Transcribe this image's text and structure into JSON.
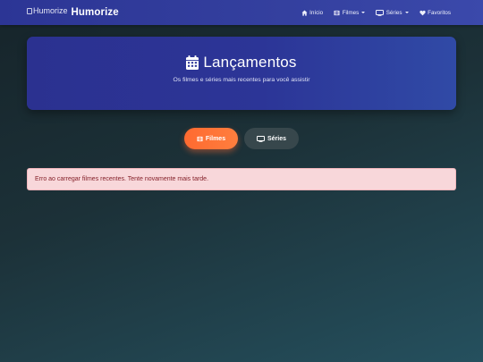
{
  "brand": {
    "logo_alt": "Humorize",
    "name": "Humorize"
  },
  "nav": {
    "items": [
      {
        "label": "Início",
        "icon": "home-icon",
        "dropdown": false
      },
      {
        "label": "Filmes",
        "icon": "film-icon",
        "dropdown": true
      },
      {
        "label": "Séries",
        "icon": "tv-icon",
        "dropdown": true
      },
      {
        "label": "Favoritos",
        "icon": "heart-icon",
        "dropdown": false
      }
    ]
  },
  "hero": {
    "icon": "calendar-icon",
    "title": "Lançamentos",
    "subtitle": "Os filmes e séries mais recentes para você assistir"
  },
  "tabs": [
    {
      "label": "Filmes",
      "icon": "film-icon",
      "active": true
    },
    {
      "label": "Séries",
      "icon": "tv-icon",
      "active": false
    }
  ],
  "alert": {
    "message": "Erro ao carregar filmes recentes. Tente novamente mais tarde."
  },
  "colors": {
    "navbar": "#313c9c",
    "hero": "#2c3597",
    "active_tab": "#ff6f35",
    "inactive_tab": "#37474c",
    "alert_bg": "#f8d7da",
    "alert_text": "#842029"
  }
}
